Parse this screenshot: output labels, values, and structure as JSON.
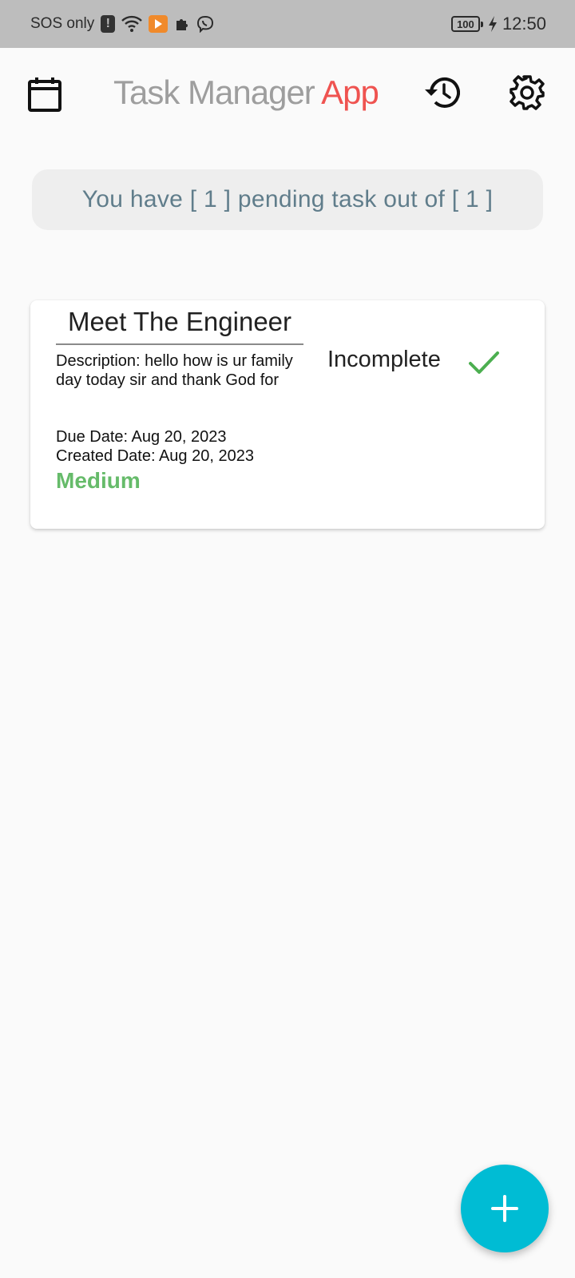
{
  "status_bar": {
    "carrier": "SOS only",
    "battery": "100",
    "time": "12:50",
    "icons": [
      "alert-icon",
      "wifi-icon",
      "play-store-icon",
      "puzzle-icon",
      "viber-icon",
      "charging-icon"
    ]
  },
  "header": {
    "title_part1": "Task Manager",
    "title_part2": "App",
    "left_icon": "calendar-icon",
    "right_icons": [
      "history-icon",
      "settings-icon"
    ]
  },
  "summary": {
    "text": "You have [ 1 ] pending task out of [ 1 ]"
  },
  "tasks": [
    {
      "title": "Meet The Engineer",
      "description": "Description: hello how is ur family day today sir and thank God for",
      "due_date": "Due Date: Aug 20, 2023",
      "created_date": "Created Date: Aug 20, 2023",
      "priority": "Medium",
      "status": "Incomplete"
    }
  ],
  "colors": {
    "accent_title": "#ef5350",
    "priority_medium": "#66bb6a",
    "fab": "#00bcd4",
    "summary_text": "#607d8b"
  },
  "fab": {
    "icon": "plus-icon"
  }
}
